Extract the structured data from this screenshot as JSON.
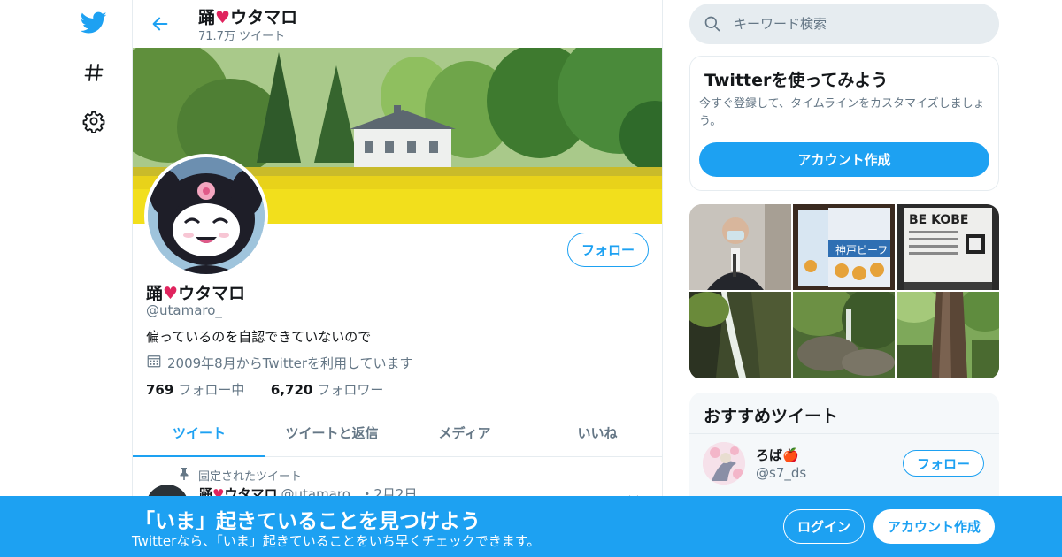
{
  "colors": {
    "accent": "#1da1f2",
    "text_secondary": "#657786",
    "text_primary": "#14171a",
    "heart": "#e0245e",
    "border": "#e6ecf0"
  },
  "nav": {
    "icons": [
      "twitter-logo-icon",
      "hashtag-icon",
      "gear-icon"
    ]
  },
  "header": {
    "name": "踊",
    "name_heart": "♥",
    "name_suffix": "ウタマロ",
    "tweet_count": "71.7万 ツイート"
  },
  "profile": {
    "name": "踊",
    "name_heart": "♥",
    "name_suffix": "ウタマロ",
    "handle": "@utamaro_",
    "bio": "偏っているのを自認できていないので",
    "joined": "2009年8月からTwitterを利用しています",
    "following_count": "769",
    "following_label": "フォロー中",
    "followers_count": "6,720",
    "followers_label": "フォロワー",
    "follow_button": "フォロー"
  },
  "tabs": [
    {
      "label": "ツイート",
      "active": true
    },
    {
      "label": "ツイートと返信",
      "active": false
    },
    {
      "label": "メディア",
      "active": false
    },
    {
      "label": "いいね",
      "active": false
    }
  ],
  "pinned": {
    "label": "固定されたツイート",
    "name": "踊",
    "name_heart": "♥",
    "name_suffix": "ウタマロ",
    "handle": "@utamaro_",
    "date": "・2月2日"
  },
  "search": {
    "placeholder": "キーワード検索"
  },
  "signup_card": {
    "title": "Twitterを使ってみよう",
    "description": "今すぐ登録して、タイムラインをカスタマイズしましょう。",
    "button": "アカウント作成"
  },
  "media_thumbnails": [
    "man-with-mask-at-microphone",
    "kobe-beef-chips-package",
    "be-kobe-sign",
    "waterfall",
    "forest-stream",
    "large-tree-trunk"
  ],
  "recommended": {
    "title": "おすすめツイート",
    "user_name": "ろば",
    "user_name_emoji": "🍎",
    "user_handle": "@s7_ds",
    "follow_button": "フォロー"
  },
  "bottom_bar": {
    "headline": "「いま」起きていることを見つけよう",
    "subtext": "Twitterなら、「いま」起きていることをいち早くチェックできます。",
    "login": "ログイン",
    "signup": "アカウント作成"
  }
}
